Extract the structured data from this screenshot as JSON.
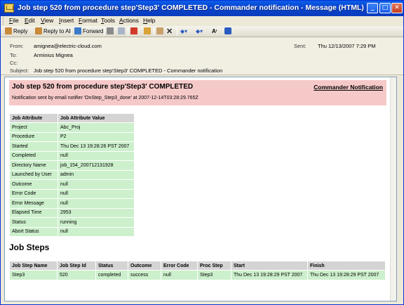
{
  "window": {
    "title": "Job step 520  from procedure step'Step3'  COMPLETED  - Commander notification - Message (HTML)",
    "buttons": {
      "minimize": "_",
      "maximize": "□",
      "close": "✕"
    }
  },
  "menu": [
    "File",
    "Edit",
    "View",
    "Insert",
    "Format",
    "Tools",
    "Actions",
    "Help"
  ],
  "toolbar": {
    "reply": "Reply",
    "reply_all": "Reply to All",
    "forward": "Forward",
    "icons": [
      "print-icon",
      "move-icon",
      "flag-icon",
      "categories-icon",
      "address-book-icon",
      "delete-icon",
      "previous-icon",
      "next-icon",
      "font-size-icon",
      "help-icon"
    ]
  },
  "header": {
    "from_label": "From:",
    "from": "amignea@electric-cloud.com",
    "to_label": "To:",
    "to": "Arminius Mignea",
    "cc_label": "Cc:",
    "cc": "",
    "subject_label": "Subject:",
    "subject": "Job step 520  from procedure step'Step3'  COMPLETED  - Commander notification",
    "sent_label": "Sent:",
    "sent": "Thu 12/13/2007 7:29 PM"
  },
  "message": {
    "title": "Job step 520 from procedure step'Step3' COMPLETED",
    "commander_link": "Commander Notification",
    "note": "Notification sent by email notifier 'OnStep_Step3_done' at 2007-12-14T03:28:29.765Z",
    "attributes": {
      "headers": [
        "Job Attribute",
        "Job Attribute Value"
      ],
      "rows": [
        [
          "Project",
          "Abc_Proj"
        ],
        [
          "Procedure",
          "P2"
        ],
        [
          "Started",
          "Thu Dec 13 19:28:26 PST 2007"
        ],
        [
          "Completed",
          "null"
        ],
        [
          "Directory Name",
          "job_154_200712131928"
        ],
        [
          "Launched by User",
          "admin"
        ],
        [
          "Outcome",
          "null"
        ],
        [
          "Error Code",
          "null"
        ],
        [
          "Error Message",
          "null"
        ],
        [
          "Elapsed Time",
          "2953"
        ],
        [
          "Status",
          "running"
        ],
        [
          "Abort Status",
          "null"
        ]
      ]
    },
    "steps_title": "Job Steps",
    "steps": {
      "headers": [
        "Job Step Name",
        "Job Step Id",
        "Status",
        "Outcome",
        "Error Code",
        "Proc Step",
        "Start",
        "Finish"
      ],
      "rows": [
        [
          "Step3",
          "520",
          "completed",
          "success",
          "null",
          "Step3",
          "Thu Dec 13 19:28:29 PST 2007",
          "Thu Dec 13 19:28:29 PST 2007"
        ]
      ]
    }
  },
  "colors": {
    "banner": "#f6c9c9",
    "cell": "#ccf0cc",
    "header_cell": "#d4d4d4",
    "titlebar": "#0a45d0"
  }
}
